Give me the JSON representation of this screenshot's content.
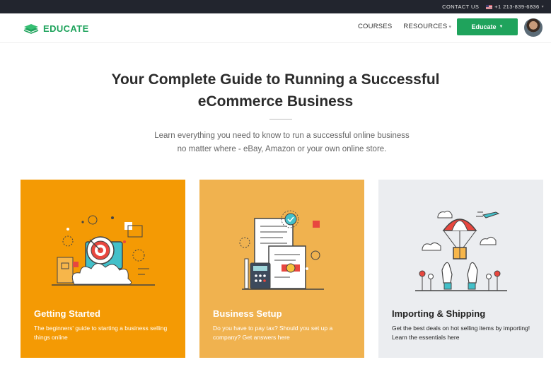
{
  "topbar": {
    "contact_label": "CONTACT US",
    "flag_icon": "us-flag-icon",
    "phone": "+1 213-839-6836"
  },
  "navbar": {
    "logo_text": "EDUCATE",
    "logo_icon": "books-stack-icon",
    "links": [
      {
        "label": "COURSES"
      },
      {
        "label": "RESOURCES"
      }
    ],
    "cta_label": "Educate",
    "accent": "#1fa35c"
  },
  "hero": {
    "title_line1": "Your Complete Guide to Running a Successful",
    "title_line2": "eCommerce Business",
    "subtitle_line1": "Learn everything you need to know to run a successful online business",
    "subtitle_line2": "no matter where - eBay, Amazon or your own online store."
  },
  "cards": [
    {
      "title": "Getting Started",
      "desc": "The beginners' guide to starting a business selling things online",
      "color": "#f49a04",
      "icon": "target-icon"
    },
    {
      "title": "Business Setup",
      "desc": "Do you have to pay tax? Should you set up a company? Get answers here",
      "color": "#f0b24f",
      "icon": "documents-calculator-icon"
    },
    {
      "title": "Importing & Shipping",
      "desc": "Get the best deals on hot selling items by importing! Learn the essentials here",
      "color": "#ebedf0",
      "icon": "parachute-package-icon"
    }
  ]
}
